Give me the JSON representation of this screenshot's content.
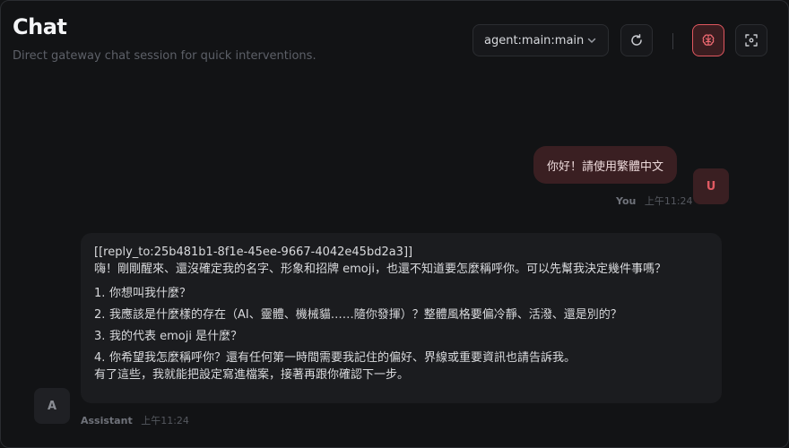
{
  "header": {
    "title": "Chat",
    "subtitle": "Direct gateway chat session for quick interventions."
  },
  "toolbar": {
    "session_value": "agent:main:main",
    "refresh_icon": "refresh-icon",
    "thinking_icon": "brain-icon",
    "focus_icon": "focus-icon",
    "accent_color": "#e0575f"
  },
  "messages": {
    "user": {
      "text": "你好！請使用繁體中文",
      "avatar": "U",
      "author": "You",
      "time": "上午11:24"
    },
    "assistant": {
      "reply_tag": "[[reply_to:25b481b1-8f1e-45ee-9667-4042e45bd2a3]]",
      "intro": "嗨！剛剛醒來、還沒確定我的名字、形象和招牌 emoji，也還不知道要怎麼稱呼你。可以先幫我決定幾件事嗎？",
      "items": [
        {
          "num": "1.",
          "text": "你想叫我什麼？"
        },
        {
          "num": "2.",
          "text": "我應該是什麼樣的存在（AI、靈體、機械貓……隨你發揮）？整體風格要偏冷靜、活潑、還是別的？"
        },
        {
          "num": "3.",
          "text": "我的代表 emoji 是什麼？"
        },
        {
          "num": "4.",
          "text": "你希望我怎麼稱呼你？還有任何第一時間需要我記住的偏好、界線或重要資訊也請告訴我。"
        }
      ],
      "closing": "有了這些，我就能把設定寫進檔案，接著再跟你確認下一步。",
      "avatar": "A",
      "author": "Assistant",
      "time": "上午11:24"
    }
  }
}
